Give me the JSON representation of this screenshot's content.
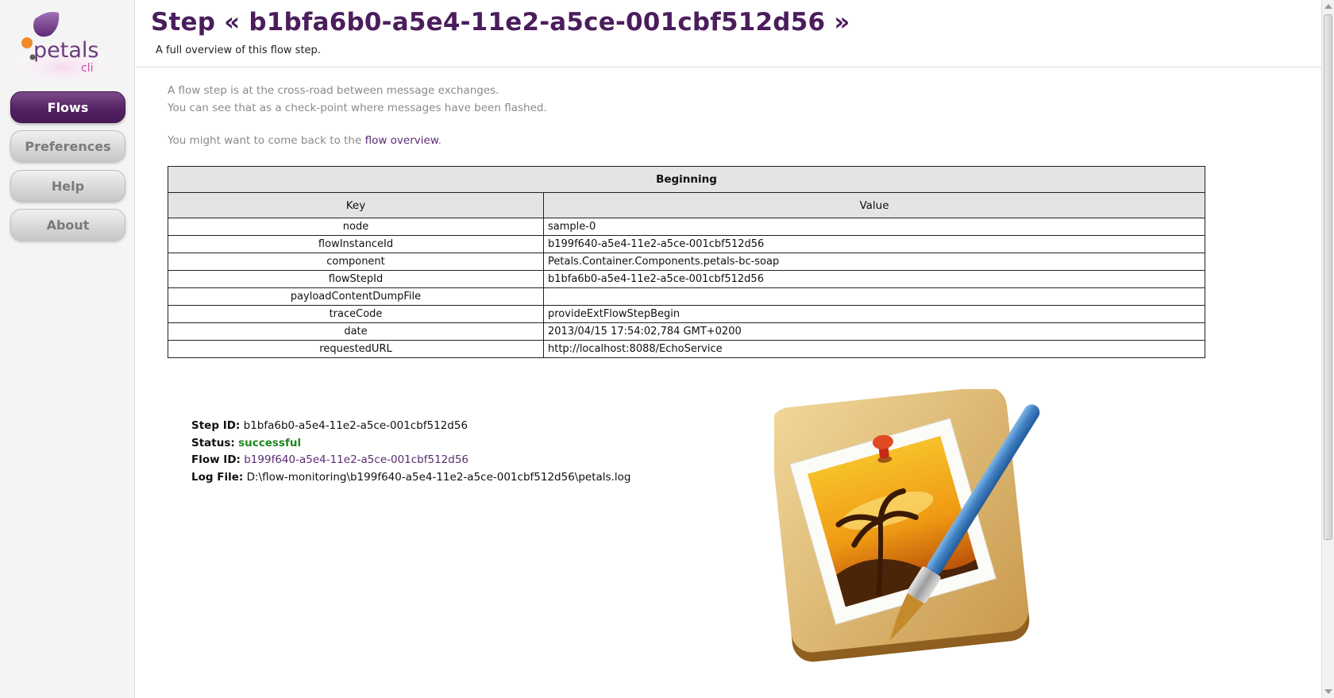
{
  "logo": {
    "brand": "petals",
    "suffix": "cli"
  },
  "nav": {
    "items": [
      {
        "label": "Flows"
      },
      {
        "label": "Preferences"
      },
      {
        "label": "Help"
      },
      {
        "label": "About"
      }
    ],
    "active": "Flows"
  },
  "header": {
    "title": "Step « b1bfa6b0-a5e4-11e2-a5ce-001cbf512d56 »",
    "subtitle": "A full overview of this flow step."
  },
  "intro": {
    "line1": "A flow step is at the cross-road between message exchanges.",
    "line2": "You can see that as a check-point where messages have been flashed.",
    "back_prefix": "You might want to come back to the ",
    "back_link": "flow overview",
    "back_suffix": "."
  },
  "table": {
    "title": "Beginning",
    "headers": [
      "Key",
      "Value"
    ],
    "rows": [
      {
        "key": "node",
        "value": "sample-0"
      },
      {
        "key": "flowInstanceId",
        "value": "b199f640-a5e4-11e2-a5ce-001cbf512d56"
      },
      {
        "key": "component",
        "value": "Petals.Container.Components.petals-bc-soap"
      },
      {
        "key": "flowStepId",
        "value": "b1bfa6b0-a5e4-11e2-a5ce-001cbf512d56"
      },
      {
        "key": "payloadContentDumpFile",
        "value": ""
      },
      {
        "key": "traceCode",
        "value": "provideExtFlowStepBegin"
      },
      {
        "key": "date",
        "value": "2013/04/15 17:54:02,784 GMT+0200"
      },
      {
        "key": "requestedURL",
        "value": "http://localhost:8088/EchoService"
      }
    ]
  },
  "details": {
    "step_id_label": "Step ID:",
    "step_id": "b1bfa6b0-a5e4-11e2-a5ce-001cbf512d56",
    "status_label": "Status:",
    "status": "successful",
    "flow_id_label": "Flow ID:",
    "flow_id": "b199f640-a5e4-11e2-a5ce-001cbf512d56",
    "log_file_label": "Log File:",
    "log_file": "D:\\flow-monitoring\\b199f640-a5e4-11e2-a5ce-001cbf512d56\\petals.log"
  },
  "colors": {
    "brand_purple": "#4b1d5c",
    "link_purple": "#5d2a73",
    "status_success": "#1e8a1e",
    "table_header_bg": "#e4e4e4"
  },
  "icons": {
    "illustration": "image-editor-app-icon",
    "logo": "petals-logo"
  }
}
